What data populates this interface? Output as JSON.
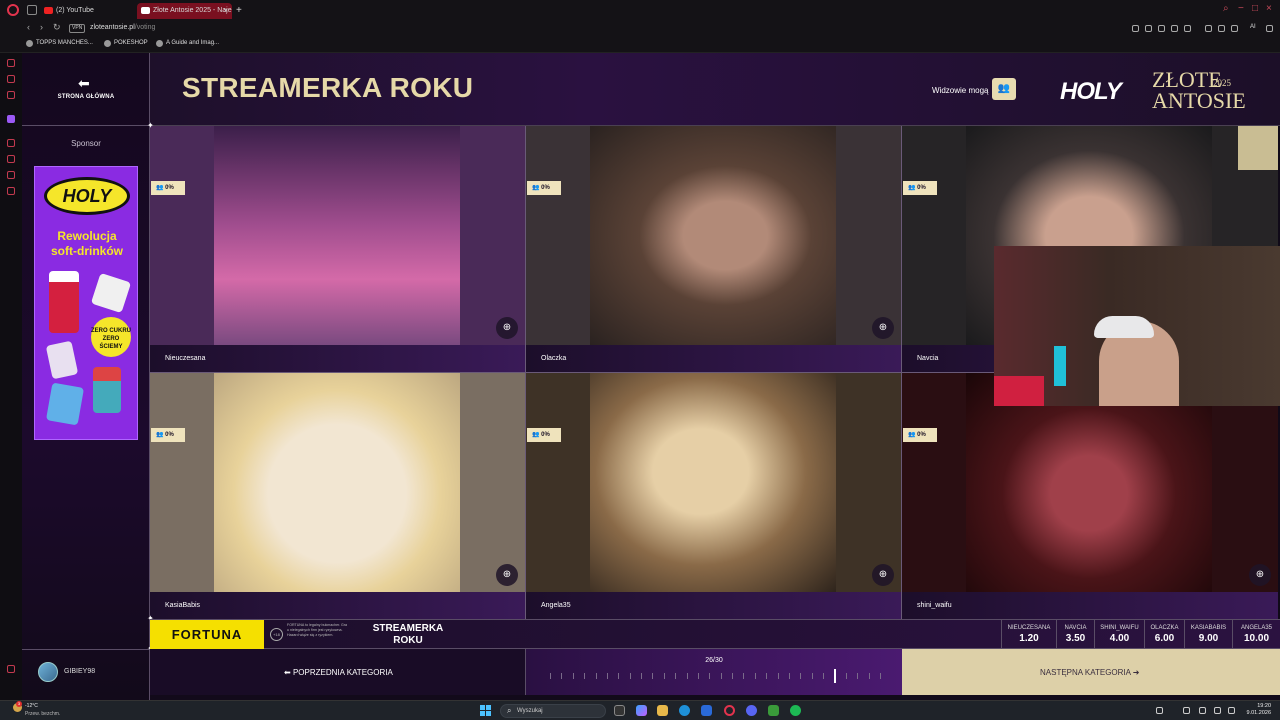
{
  "browser": {
    "tabs": [
      {
        "label": "(2) YouTube",
        "active": false
      },
      {
        "label": "Złote Antosie 2025 - Naje",
        "active": true
      }
    ],
    "url_host": "zloteantosie.pl",
    "url_path": "/voting",
    "vpn_label": "VPN",
    "ai_label": "AI",
    "bookmarks": [
      "TOPPS MANCHES...",
      "POKESHOP",
      "A Guide and Imag..."
    ]
  },
  "sidebar": {
    "home_label": "STRONA GŁÓWNA",
    "sponsor_label": "Sponsor",
    "ad": {
      "logo": "HOLY",
      "line1": "Rewolucja",
      "line2": "soft-drinków",
      "badge": "ZERO CUKRU ZERO ŚCIEMY"
    },
    "username": "GIBIEY98"
  },
  "header": {
    "category_title": "STREAMERKA ROKU",
    "viewers_label": "Widzowie mogą",
    "brand_holy": "HOLY",
    "brand_title_line1": "ZŁOTE",
    "brand_title_line2": "ANTOSIE",
    "brand_year": "2025"
  },
  "nominees": [
    {
      "name": "Nieuczesana",
      "percent": "0%"
    },
    {
      "name": "Olaczka",
      "percent": "0%"
    },
    {
      "name": "Navcia",
      "percent": "0%"
    },
    {
      "name": "KasiaBabis",
      "percent": "0%"
    },
    {
      "name": "Angela35",
      "percent": "0%"
    },
    {
      "name": "shini_waifu",
      "percent": "0%"
    }
  ],
  "odds_bar": {
    "brand": "FORTUNA",
    "age_badge": "+18",
    "disclaimer": "FORTUNA to legalny bukmacher. Gra u nielegalnych firm jest ryzykowna. Hazard wiąże się z ryzykiem.",
    "category_line1": "STREAMERKA",
    "category_line2": "ROKU",
    "odds": [
      {
        "name": "NIEUCZESANA",
        "value": "1.20"
      },
      {
        "name": "NAVCIA",
        "value": "3.50"
      },
      {
        "name": "SHINI_WAIFU",
        "value": "4.00"
      },
      {
        "name": "OLACZKA",
        "value": "6.00"
      },
      {
        "name": "KASIABABIS",
        "value": "9.00"
      },
      {
        "name": "ANGELA35",
        "value": "10.00"
      }
    ]
  },
  "footer_nav": {
    "prev_label": "POPRZEDNIA KATEGORIA",
    "progress_label": "26/30",
    "progress_current": 26,
    "progress_total": 30,
    "next_label": "NASTĘPNA KATEGORIA"
  },
  "taskbar": {
    "weather_temp": "-12°C",
    "weather_desc": "Przew. bezchm.",
    "weather_badge": "3",
    "search_placeholder": "Wyszukaj",
    "time": "19:20",
    "date": "9.01.2026"
  },
  "colors": {
    "accent_gold": "#e6d9a8",
    "fortuna_yellow": "#f5e000",
    "opera_red": "#e2334d",
    "page_bg": "#100a18"
  }
}
